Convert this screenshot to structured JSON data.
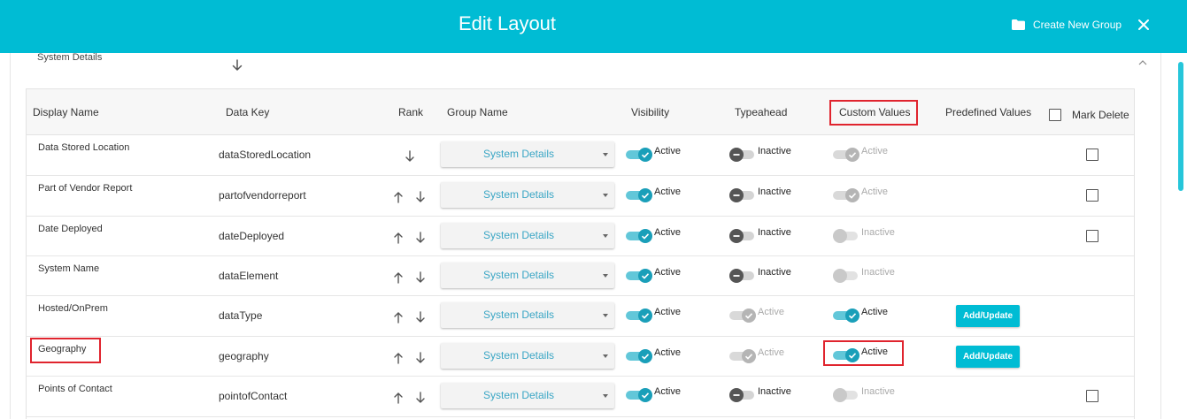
{
  "header": {
    "title": "Edit Layout",
    "create_group_label": "Create New Group",
    "background_color": "#00bcd4"
  },
  "section": {
    "title": "System Details"
  },
  "table": {
    "columns": {
      "display_name": "Display Name",
      "data_key": "Data Key",
      "rank": "Rank",
      "group_name": "Group Name",
      "visibility": "Visibility",
      "typeahead": "Typeahead",
      "custom_values": "Custom Values",
      "predefined_values": "Predefined Values",
      "mark_delete": "Mark Delete"
    },
    "rows": [
      {
        "display_name": "Data Stored Location",
        "data_key": "dataStoredLocation",
        "group": "System Details",
        "visibility": "Active",
        "typeahead": "Inactive",
        "custom_values": "Active"
      },
      {
        "display_name": "Part of Vendor Report",
        "data_key": "partofvendorreport",
        "group": "System Details",
        "visibility": "Active",
        "typeahead": "Inactive",
        "custom_values": "Active"
      },
      {
        "display_name": "Date Deployed",
        "data_key": "dateDeployed",
        "group": "System Details",
        "visibility": "Active",
        "typeahead": "Inactive",
        "custom_values": "Inactive"
      },
      {
        "display_name": "System Name",
        "data_key": "dataElement",
        "group": "System Details",
        "visibility": "Active",
        "typeahead": "Inactive",
        "custom_values": "Inactive"
      },
      {
        "display_name": "Hosted/OnPrem",
        "data_key": "dataType",
        "group": "System Details",
        "visibility": "Active",
        "typeahead": "Active",
        "custom_values": "Active",
        "predefined_button": "Add/Update"
      },
      {
        "display_name": "Geography",
        "data_key": "geography",
        "group": "System Details",
        "visibility": "Active",
        "typeahead": "Active",
        "custom_values": "Active",
        "predefined_button": "Add/Update"
      },
      {
        "display_name": "Points of Contact",
        "data_key": "pointofContact",
        "group": "System Details",
        "visibility": "Active",
        "typeahead": "Inactive",
        "custom_values": "Inactive"
      }
    ]
  },
  "colors": {
    "accent": "#00bcd4",
    "toggle_on": "#1a9fb9",
    "highlight_box": "#e0242e",
    "group_text": "#3aa6c5"
  },
  "icons": {
    "folder": "folder-icon",
    "close": "close-icon",
    "arrow_up": "arrow-up-icon",
    "arrow_down": "arrow-down-icon",
    "chevron_up": "chevron-up-icon",
    "check": "check-icon",
    "minus": "minus-icon"
  }
}
